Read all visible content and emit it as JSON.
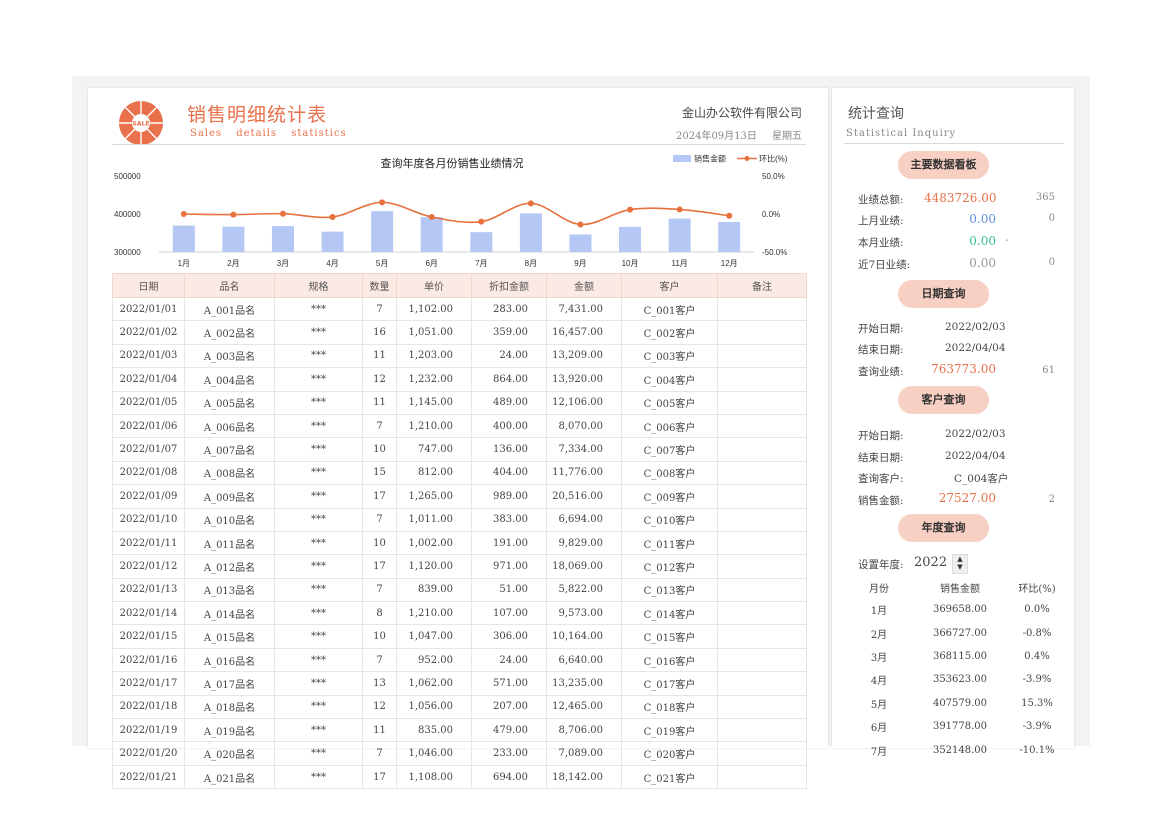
{
  "header": {
    "title_cn": "销售明细统计表",
    "title_en": "Sales  details  statistics",
    "company": "金山办公软件有限公司",
    "date": "2024年09月13日",
    "weekday": "星期五",
    "logo_text": "SALE"
  },
  "chart_data": {
    "type": "bar",
    "title": "查询年度各月份销售业绩情况",
    "categories": [
      "1月",
      "2月",
      "3月",
      "4月",
      "5月",
      "6月",
      "7月",
      "8月",
      "9月",
      "10月",
      "11月",
      "12月"
    ],
    "series": [
      {
        "name": "销售金额",
        "type": "bar",
        "axis": "left",
        "values": [
          369658,
          366727,
          368115,
          353623,
          407579,
          391778,
          352148,
          401500,
          346000,
          366000,
          388000,
          379000
        ]
      },
      {
        "name": "环比(%)",
        "type": "line",
        "axis": "right",
        "values": [
          0.0,
          -0.8,
          0.4,
          -3.9,
          15.3,
          -3.9,
          -10.1,
          14.0,
          -13.8,
          5.8,
          6.0,
          -2.3
        ]
      }
    ],
    "y_left": {
      "ticks": [
        "500000",
        "400000",
        "300000"
      ],
      "range": [
        300000,
        500000
      ]
    },
    "y_right": {
      "ticks": [
        "50.0%",
        "0.0%",
        "-50.0%"
      ],
      "range": [
        -50,
        50
      ]
    },
    "colors": {
      "bar": "#b4c7f5",
      "line": "#e8703c"
    },
    "legend_position": "top-right"
  },
  "table": {
    "headers": [
      "日期",
      "品名",
      "规格",
      "数量",
      "单价",
      "折扣金额",
      "金额",
      "客户",
      "备注"
    ],
    "rows": [
      [
        "2022/01/01",
        "A_001品名",
        "***",
        "7",
        "1,102.00",
        "283.00",
        "7,431.00",
        "C_001客户",
        ""
      ],
      [
        "2022/01/02",
        "A_002品名",
        "***",
        "16",
        "1,051.00",
        "359.00",
        "16,457.00",
        "C_002客户",
        ""
      ],
      [
        "2022/01/03",
        "A_003品名",
        "***",
        "11",
        "1,203.00",
        "24.00",
        "13,209.00",
        "C_003客户",
        ""
      ],
      [
        "2022/01/04",
        "A_004品名",
        "***",
        "12",
        "1,232.00",
        "864.00",
        "13,920.00",
        "C_004客户",
        ""
      ],
      [
        "2022/01/05",
        "A_005品名",
        "***",
        "11",
        "1,145.00",
        "489.00",
        "12,106.00",
        "C_005客户",
        ""
      ],
      [
        "2022/01/06",
        "A_006品名",
        "***",
        "7",
        "1,210.00",
        "400.00",
        "8,070.00",
        "C_006客户",
        ""
      ],
      [
        "2022/01/07",
        "A_007品名",
        "***",
        "10",
        "747.00",
        "136.00",
        "7,334.00",
        "C_007客户",
        ""
      ],
      [
        "2022/01/08",
        "A_008品名",
        "***",
        "15",
        "812.00",
        "404.00",
        "11,776.00",
        "C_008客户",
        ""
      ],
      [
        "2022/01/09",
        "A_009品名",
        "***",
        "17",
        "1,265.00",
        "989.00",
        "20,516.00",
        "C_009客户",
        ""
      ],
      [
        "2022/01/10",
        "A_010品名",
        "***",
        "7",
        "1,011.00",
        "383.00",
        "6,694.00",
        "C_010客户",
        ""
      ],
      [
        "2022/01/11",
        "A_011品名",
        "***",
        "10",
        "1,002.00",
        "191.00",
        "9,829.00",
        "C_011客户",
        ""
      ],
      [
        "2022/01/12",
        "A_012品名",
        "***",
        "17",
        "1,120.00",
        "971.00",
        "18,069.00",
        "C_012客户",
        ""
      ],
      [
        "2022/01/13",
        "A_013品名",
        "***",
        "7",
        "839.00",
        "51.00",
        "5,822.00",
        "C_013客户",
        ""
      ],
      [
        "2022/01/14",
        "A_014品名",
        "***",
        "8",
        "1,210.00",
        "107.00",
        "9,573.00",
        "C_014客户",
        ""
      ],
      [
        "2022/01/15",
        "A_015品名",
        "***",
        "10",
        "1,047.00",
        "306.00",
        "10,164.00",
        "C_015客户",
        ""
      ],
      [
        "2022/01/16",
        "A_016品名",
        "***",
        "7",
        "952.00",
        "24.00",
        "6,640.00",
        "C_016客户",
        ""
      ],
      [
        "2022/01/17",
        "A_017品名",
        "***",
        "13",
        "1,062.00",
        "571.00",
        "13,235.00",
        "C_017客户",
        ""
      ],
      [
        "2022/01/18",
        "A_018品名",
        "***",
        "12",
        "1,056.00",
        "207.00",
        "12,465.00",
        "C_018客户",
        ""
      ],
      [
        "2022/01/19",
        "A_019品名",
        "***",
        "11",
        "835.00",
        "479.00",
        "8,706.00",
        "C_019客户",
        ""
      ],
      [
        "2022/01/20",
        "A_020品名",
        "***",
        "7",
        "1,046.00",
        "233.00",
        "7,089.00",
        "C_020客户",
        ""
      ],
      [
        "2022/01/21",
        "A_021品名",
        "***",
        "17",
        "1,108.00",
        "694.00",
        "18,142.00",
        "C_021客户",
        ""
      ]
    ]
  },
  "right": {
    "title": "统计查询",
    "subtitle": "Statistical Inquiry",
    "dashboard": {
      "button": "主要数据看板",
      "rows": [
        {
          "label": "业绩总额:",
          "value": "4483726.00",
          "count": "365",
          "color": "#e8704a"
        },
        {
          "label": "上月业绩:",
          "value": "0.00",
          "count": "0",
          "color": "#5b8fd6"
        },
        {
          "label": "本月业绩:",
          "value": "0.00",
          "count": "-",
          "color": "#3cc08a"
        },
        {
          "label": "近7日业绩:",
          "value": "0.00",
          "count": "0",
          "color": "#999999"
        }
      ]
    },
    "date_query": {
      "button": "日期查询",
      "start_label": "开始日期:",
      "start": "2022/02/03",
      "end_label": "结束日期:",
      "end": "2022/04/04",
      "result_label": "查询业绩:",
      "result": "763773.00",
      "count": "61"
    },
    "customer_query": {
      "button": "客户查询",
      "start_label": "开始日期:",
      "start": "2022/02/03",
      "end_label": "结束日期:",
      "end": "2022/04/04",
      "customer_label": "查询客户:",
      "customer": "C_004客户",
      "result_label": "销售金额:",
      "result": "27527.00",
      "count": "2"
    },
    "year_query": {
      "button": "年度查询",
      "year_label": "设置年度:",
      "year": "2022",
      "headers": [
        "月份",
        "销售金额",
        "环比(%)"
      ],
      "rows": [
        [
          "1月",
          "369658.00",
          "0.0%"
        ],
        [
          "2月",
          "366727.00",
          "-0.8%"
        ],
        [
          "3月",
          "368115.00",
          "0.4%"
        ],
        [
          "4月",
          "353623.00",
          "-3.9%"
        ],
        [
          "5月",
          "407579.00",
          "15.3%"
        ],
        [
          "6月",
          "391778.00",
          "-3.9%"
        ],
        [
          "7月",
          "352148.00",
          "-10.1%"
        ]
      ]
    }
  }
}
